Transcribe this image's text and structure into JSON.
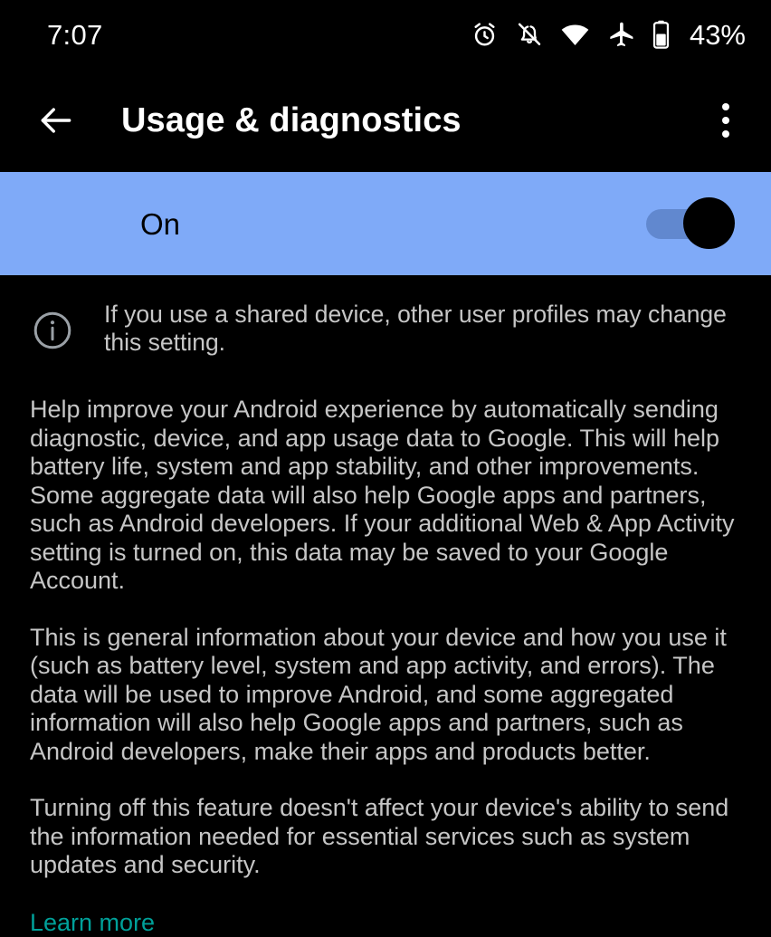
{
  "status_bar": {
    "time": "7:07",
    "battery_percent": "43%",
    "icons": [
      "alarm-icon",
      "notifications-off-icon",
      "wifi-icon",
      "airplane-mode-icon",
      "battery-icon"
    ]
  },
  "app_bar": {
    "back_icon": "back-arrow-icon",
    "title": "Usage & diagnostics",
    "overflow_icon": "overflow-menu-icon"
  },
  "toggle_banner": {
    "label": "On",
    "checked": true,
    "background_color": "#7faaf8",
    "thumb_color": "#000000"
  },
  "info_notice": {
    "icon": "info-icon",
    "text": "If you use a shared device, other user profiles may change this setting."
  },
  "body": {
    "paragraph_1": "Help improve your Android experience by automatically sending diagnostic, device, and app usage data to Google. This will help battery life, system and app stability, and other improvements. Some aggregate data will also help Google apps and partners, such as Android developers. If your additional Web & App Activity setting is turned on, this data may be saved to your Google Account.",
    "paragraph_2": "This is general information about your device and how you use it (such as battery level, system and app activity, and errors). The data will be used to improve Android, and some aggregated information will also help Google apps and partners, such as Android developers, make their apps and products better.",
    "paragraph_3": "Turning off this feature doesn't affect your device's ability to send the information needed for essential services such as system updates and security.",
    "learn_more_label": "Learn more",
    "learn_more_color": "#00a099",
    "text_color": "#c6c6c6"
  }
}
